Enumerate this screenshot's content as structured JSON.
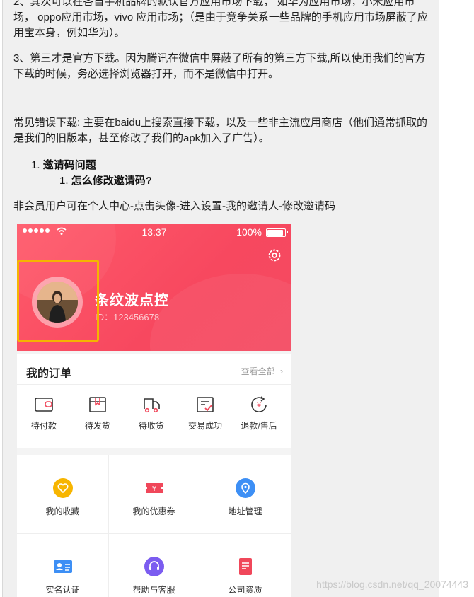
{
  "paragraphs": {
    "p1": "2、其次可以在各自手机品牌的默认官方应用市场下载， 如华为应用市场，小米应用市场， oppo应用市场，vivo 应用市场；（是由于竞争关系一些品牌的手机应用市场屏蔽了应用宝本身，例如华为）。",
    "p2": "3、第三才是官方下载。因为腾讯在微信中屏蔽了所有的第三方下载,所以使用我们的官方下载的时候，务必选择浏览器打开，而不是微信中打开。",
    "p3": "常见错误下载: 主要在baidu上搜索直接下载，以及一些非主流应用商店（他们通常抓取的是我们的旧版本，甚至修改了我们的apk加入了广告）。",
    "p4": "非会员用户可在个人中心-点击头像-进入设置-我的邀请人-修改邀请码"
  },
  "list": {
    "item1_num": "1.",
    "item1": "邀请码问题",
    "item2_num": "1.",
    "item2": "怎么修改邀请码?"
  },
  "phone": {
    "time": "13:37",
    "battery": "100%",
    "nickname": "条纹波点控",
    "uid": "ID：123456678",
    "orders_title": "我的订单",
    "orders_all": "查看全部",
    "orders": [
      {
        "label": "待付款",
        "icon": "wallet-icon"
      },
      {
        "label": "待发货",
        "icon": "package-icon"
      },
      {
        "label": "待收货",
        "icon": "truck-icon"
      },
      {
        "label": "交易成功",
        "icon": "checklist-icon"
      },
      {
        "label": "退款/售后",
        "icon": "refund-icon"
      }
    ],
    "grid": [
      {
        "label": "我的收藏",
        "icon": "heart-icon",
        "color": "#f7b500"
      },
      {
        "label": "我的优惠券",
        "icon": "coupon-icon",
        "color": "#f0475a"
      },
      {
        "label": "地址管理",
        "icon": "location-icon",
        "color": "#3d8ff5"
      },
      {
        "label": "实名认证",
        "icon": "id-card-icon",
        "color": "#3d8ff5"
      },
      {
        "label": "帮助与客服",
        "icon": "headset-icon",
        "color": "#7b5cf0"
      },
      {
        "label": "公司资质",
        "icon": "document-icon",
        "color": "#f0475a"
      }
    ]
  },
  "watermark": "https://blog.csdn.net/qq_20074443",
  "colors": {
    "hero": "#f7485f",
    "highlight": "#f5b400"
  }
}
